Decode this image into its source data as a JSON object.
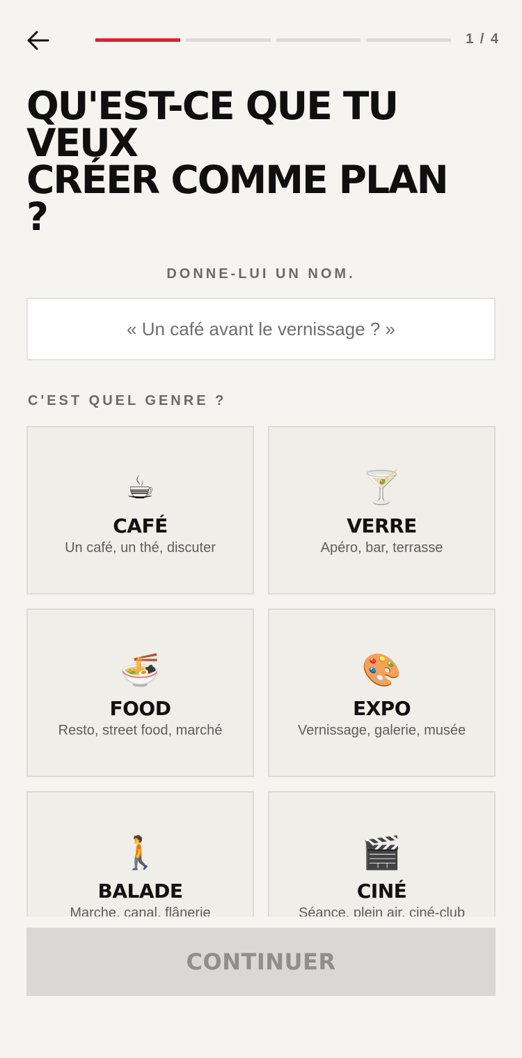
{
  "header": {
    "step_count": "1 / 4",
    "progress": {
      "current": 1,
      "total": 4
    }
  },
  "title": "QU'EST-CE QUE TU VEUX\nCRÉER COMME PLAN ?",
  "name_section": {
    "label": "DONNE-LUI UN NOM.",
    "placeholder": "« Un café avant le vernissage ? »",
    "value": ""
  },
  "genre_section": {
    "label": "C'EST QUEL GENRE ?",
    "cards": [
      {
        "emoji": "☕",
        "name": "CAFÉ",
        "desc": "Un café, un thé, discuter"
      },
      {
        "emoji": "🍸",
        "name": "VERRE",
        "desc": "Apéro, bar, terrasse"
      },
      {
        "emoji": "🍜",
        "name": "FOOD",
        "desc": "Resto, street food, marché"
      },
      {
        "emoji": "🎨",
        "name": "EXPO",
        "desc": "Vernissage, galerie, musée"
      },
      {
        "emoji": "🚶",
        "name": "BALADE",
        "desc": "Marche, canal, flânerie"
      },
      {
        "emoji": "🎬",
        "name": "CINÉ",
        "desc": "Séance, plein air, ciné-club"
      }
    ]
  },
  "footer": {
    "continue_label": "CONTINUER"
  },
  "colors": {
    "accent": "#e0202c",
    "background": "#f5f4f0",
    "card_bg": "#efeee8",
    "button_disabled": "#d9d8d4"
  },
  "icons": {
    "back": "arrow-left-icon"
  }
}
